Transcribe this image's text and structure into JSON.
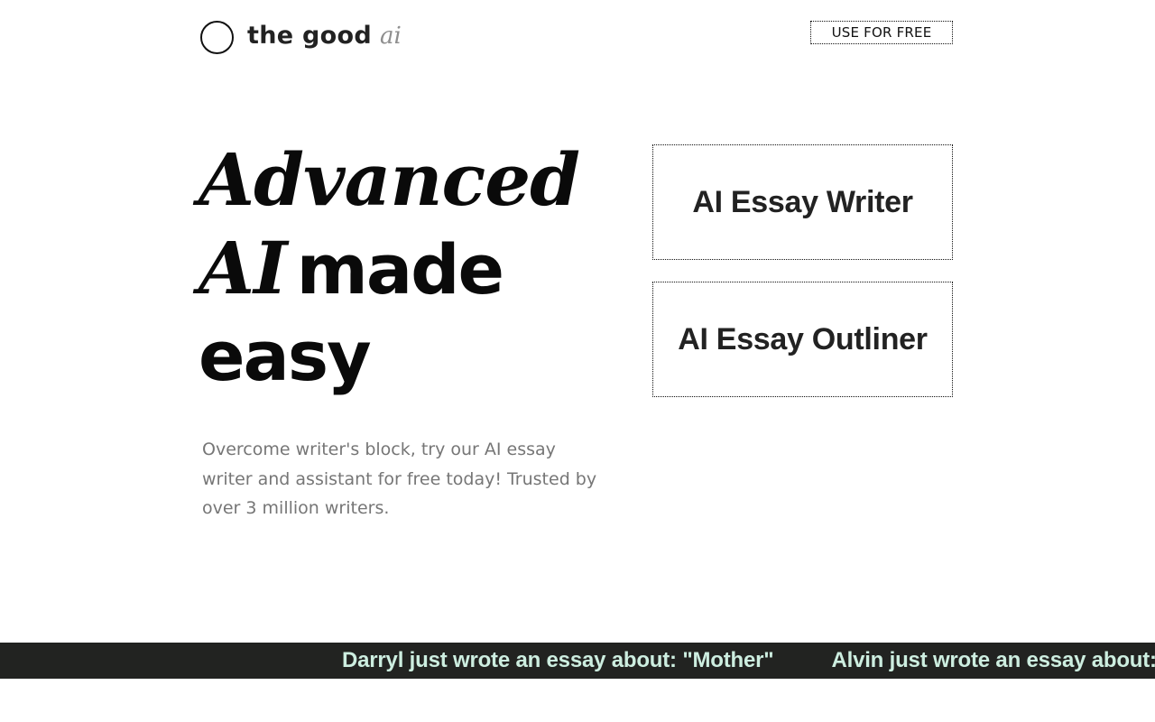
{
  "header": {
    "logo_text": "the good",
    "logo_ai": "ai",
    "cta_label": "USE FOR FREE"
  },
  "hero": {
    "title_line1": "Advanced",
    "title_line2_italic": "AI",
    "title_line2_bold": "made",
    "title_line3": "easy",
    "subtitle": "Overcome writer's block, try our AI essay writer and assistant for free today! Trusted by over 3 million writers."
  },
  "tools": [
    {
      "label": "AI Essay Writer"
    },
    {
      "label": "AI Essay Outliner"
    }
  ],
  "ticker": {
    "items": [
      "Darryl just wrote an essay about: \"Mother\"",
      "Alvin just wrote an essay about:"
    ]
  },
  "colors": {
    "ticker_bg": "#222321",
    "ticker_text": "#cdeee0",
    "subtitle_text": "#767676",
    "logo_ai_text": "#8e8e8e"
  },
  "icons": {
    "logo": "circle-logo-icon"
  }
}
